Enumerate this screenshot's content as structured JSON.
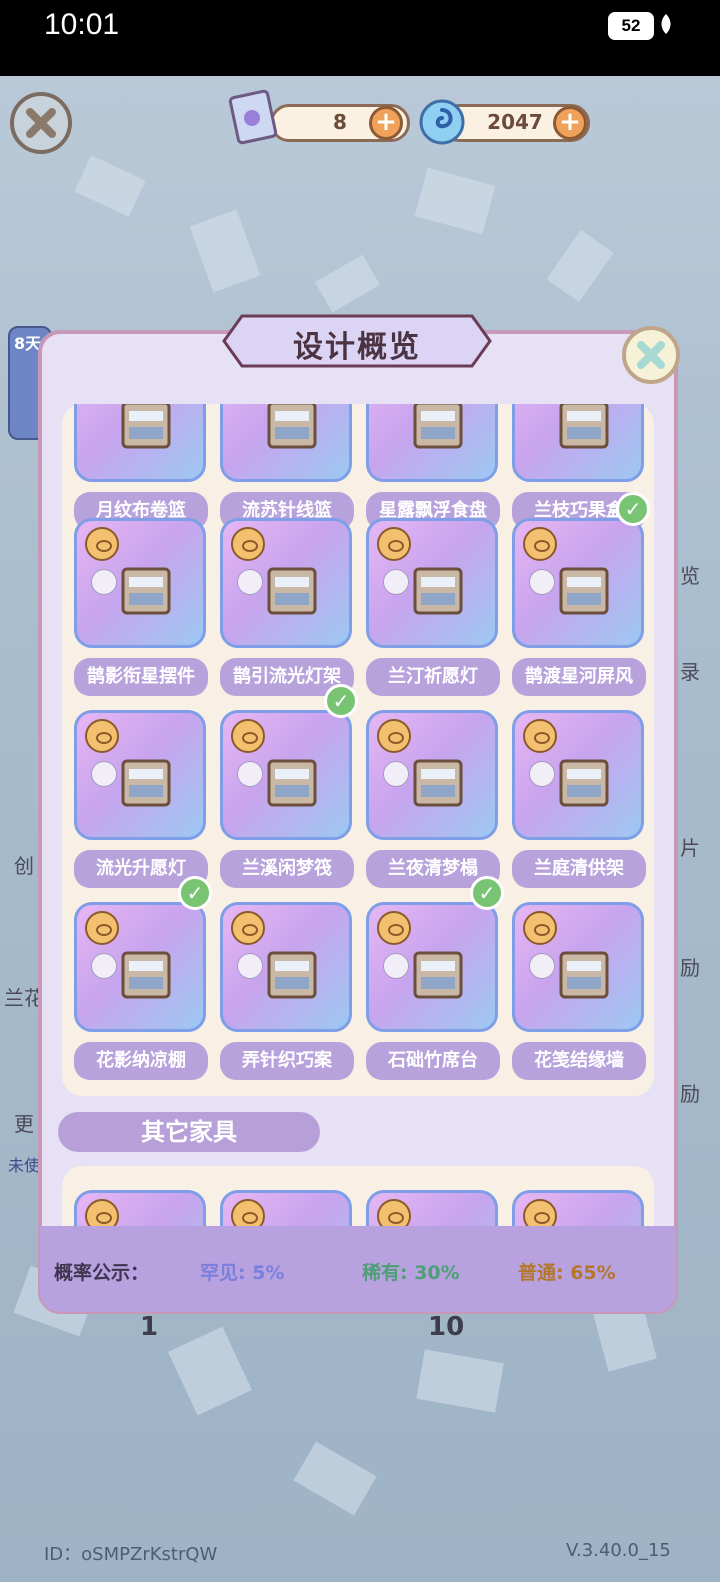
{
  "status": {
    "time": "10:01",
    "battery": "52"
  },
  "currency": {
    "scrolls": "8",
    "gems": "2047"
  },
  "modal": {
    "title": "设计概览"
  },
  "rows": [
    [
      "月纹布卷篮",
      "流苏针线篮",
      "星露飘浮食盘",
      "兰枝巧果盒"
    ],
    [
      "鹊影衔星摆件",
      "鹊引流光灯架",
      "兰汀祈愿灯",
      "鹊渡星河屏风"
    ],
    [
      "流光升愿灯",
      "兰溪闲梦筏",
      "兰夜清梦榻",
      "兰庭清供架"
    ],
    [
      "花影纳凉棚",
      "弄针织巧案",
      "石础竹席台",
      "花笺结缘墙"
    ]
  ],
  "owned": [
    [
      false,
      true,
      false,
      false
    ],
    [
      false,
      false,
      false,
      true
    ],
    [
      false,
      true,
      false,
      false
    ],
    [
      true,
      false,
      true,
      false
    ]
  ],
  "section": {
    "other": "其它家具"
  },
  "probability": {
    "label": "概率公示：",
    "rare": "罕见: 5%",
    "uncommon": "稀有: 30%",
    "common": "普通: 65%"
  },
  "colors": {
    "rare": "#7b7fdc",
    "uncommon": "#4f9e78",
    "common": "#b5772c"
  },
  "background": {
    "left_badge": "8天",
    "side_labels": [
      "览",
      "录",
      "片",
      "励",
      "励"
    ],
    "left_labels": [
      "创",
      "兰花",
      "更",
      "未使"
    ],
    "bottom_nums": [
      "1",
      "10"
    ]
  },
  "footer": {
    "id": "ID：oSMPZrKstrQW",
    "version": "V.3.40.0_15"
  }
}
